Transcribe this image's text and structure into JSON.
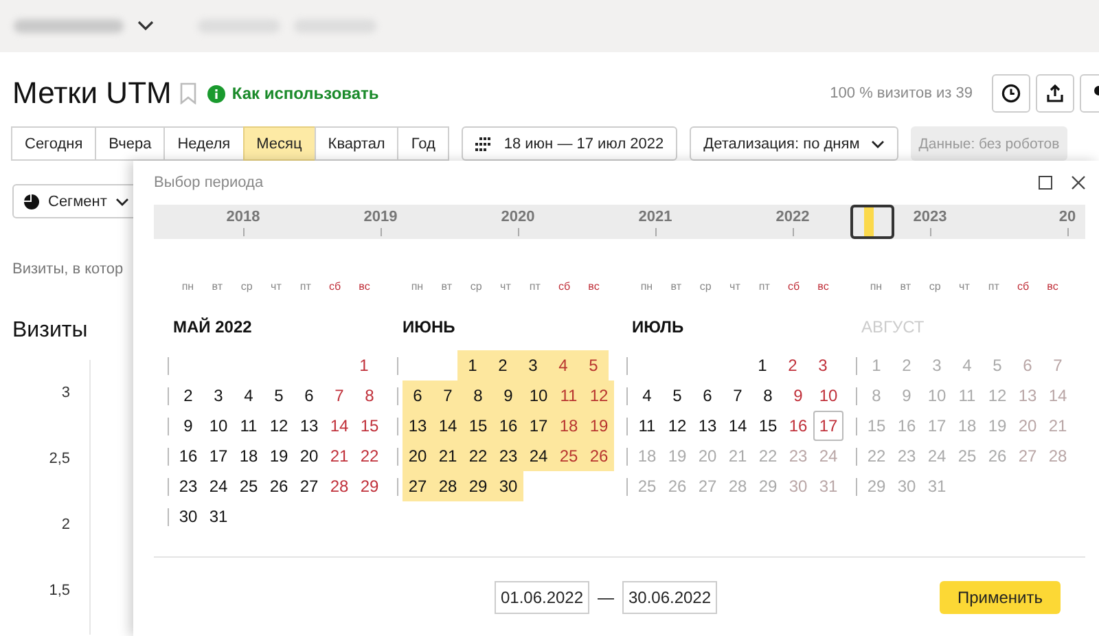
{
  "page": {
    "title": "Метки UTM",
    "help_link": "Как использовать",
    "visits_note": "100 % визитов из 39"
  },
  "periods": [
    {
      "label": "Сегодня",
      "selected": false
    },
    {
      "label": "Вчера",
      "selected": false
    },
    {
      "label": "Неделя",
      "selected": false
    },
    {
      "label": "Месяц",
      "selected": true
    },
    {
      "label": "Квартал",
      "selected": false
    },
    {
      "label": "Год",
      "selected": false
    }
  ],
  "date_range": "18 июн — 17 июл 2022",
  "detail": "Детализация: по дням",
  "data_filter": "Данные: без роботов",
  "segment": "Сегмент",
  "visits_text": "Визиты, в котор",
  "chart_title": "Визиты",
  "y_labels": [
    "3",
    "2,5",
    "2",
    "1,5"
  ],
  "popup": {
    "title": "Выбор периода",
    "years": [
      "2018",
      "2019",
      "2020",
      "2021",
      "2022",
      "2023",
      "20"
    ],
    "months": [
      {
        "name": "МАЙ 2022",
        "disabled": false,
        "weekdays": [
          {
            "label": "пн",
            "weekend": false
          },
          {
            "label": "вт",
            "weekend": false
          },
          {
            "label": "ср",
            "weekend": false
          },
          {
            "label": "чт",
            "weekend": false
          },
          {
            "label": "пт",
            "weekend": false
          },
          {
            "label": "сб",
            "weekend": true
          },
          {
            "label": "вс",
            "weekend": true
          }
        ],
        "weeks": [
          {
            "kind": "first",
            "days": [
              {
                "n": "1",
                "weekend": true,
                "selected": false,
                "disabled": false,
                "today": false
              }
            ]
          },
          {
            "kind": "week",
            "days": [
              {
                "n": "2",
                "weekend": false,
                "selected": false,
                "disabled": false,
                "today": false
              },
              {
                "n": "3",
                "weekend": false,
                "selected": false,
                "disabled": false,
                "today": false
              },
              {
                "n": "4",
                "weekend": false,
                "selected": false,
                "disabled": false,
                "today": false
              },
              {
                "n": "5",
                "weekend": false,
                "selected": false,
                "disabled": false,
                "today": false
              },
              {
                "n": "6",
                "weekend": false,
                "selected": false,
                "disabled": false,
                "today": false
              },
              {
                "n": "7",
                "weekend": true,
                "selected": false,
                "disabled": false,
                "today": false
              },
              {
                "n": "8",
                "weekend": true,
                "selected": false,
                "disabled": false,
                "today": false
              }
            ]
          },
          {
            "kind": "week",
            "days": [
              {
                "n": "9",
                "weekend": false,
                "selected": false,
                "disabled": false,
                "today": false
              },
              {
                "n": "10",
                "weekend": false,
                "selected": false,
                "disabled": false,
                "today": false
              },
              {
                "n": "11",
                "weekend": false,
                "selected": false,
                "disabled": false,
                "today": false
              },
              {
                "n": "12",
                "weekend": false,
                "selected": false,
                "disabled": false,
                "today": false
              },
              {
                "n": "13",
                "weekend": false,
                "selected": false,
                "disabled": false,
                "today": false
              },
              {
                "n": "14",
                "weekend": true,
                "selected": false,
                "disabled": false,
                "today": false
              },
              {
                "n": "15",
                "weekend": true,
                "selected": false,
                "disabled": false,
                "today": false
              }
            ]
          },
          {
            "kind": "week",
            "days": [
              {
                "n": "16",
                "weekend": false,
                "selected": false,
                "disabled": false,
                "today": false
              },
              {
                "n": "17",
                "weekend": false,
                "selected": false,
                "disabled": false,
                "today": false
              },
              {
                "n": "18",
                "weekend": false,
                "selected": false,
                "disabled": false,
                "today": false
              },
              {
                "n": "19",
                "weekend": false,
                "selected": false,
                "disabled": false,
                "today": false
              },
              {
                "n": "20",
                "weekend": false,
                "selected": false,
                "disabled": false,
                "today": false
              },
              {
                "n": "21",
                "weekend": true,
                "selected": false,
                "disabled": false,
                "today": false
              },
              {
                "n": "22",
                "weekend": true,
                "selected": false,
                "disabled": false,
                "today": false
              }
            ]
          },
          {
            "kind": "week",
            "days": [
              {
                "n": "23",
                "weekend": false,
                "selected": false,
                "disabled": false,
                "today": false
              },
              {
                "n": "24",
                "weekend": false,
                "selected": false,
                "disabled": false,
                "today": false
              },
              {
                "n": "25",
                "weekend": false,
                "selected": false,
                "disabled": false,
                "today": false
              },
              {
                "n": "26",
                "weekend": false,
                "selected": false,
                "disabled": false,
                "today": false
              },
              {
                "n": "27",
                "weekend": false,
                "selected": false,
                "disabled": false,
                "today": false
              },
              {
                "n": "28",
                "weekend": true,
                "selected": false,
                "disabled": false,
                "today": false
              },
              {
                "n": "29",
                "weekend": true,
                "selected": false,
                "disabled": false,
                "today": false
              }
            ]
          },
          {
            "kind": "week",
            "days": [
              {
                "n": "30",
                "weekend": false,
                "selected": false,
                "disabled": false,
                "today": false
              },
              {
                "n": "31",
                "weekend": false,
                "selected": false,
                "disabled": false,
                "today": false
              }
            ]
          }
        ]
      },
      {
        "name": "ИЮНЬ",
        "disabled": false,
        "weekdays": [
          {
            "label": "пн",
            "weekend": false
          },
          {
            "label": "вт",
            "weekend": false
          },
          {
            "label": "ср",
            "weekend": false
          },
          {
            "label": "чт",
            "weekend": false
          },
          {
            "label": "пт",
            "weekend": false
          },
          {
            "label": "сб",
            "weekend": true
          },
          {
            "label": "вс",
            "weekend": true
          }
        ],
        "weeks": [
          {
            "kind": "first",
            "days": [
              {
                "n": "1",
                "weekend": false,
                "selected": true,
                "disabled": false,
                "today": false
              },
              {
                "n": "2",
                "weekend": false,
                "selected": true,
                "disabled": false,
                "today": false
              },
              {
                "n": "3",
                "weekend": false,
                "selected": true,
                "disabled": false,
                "today": false
              },
              {
                "n": "4",
                "weekend": true,
                "selected": true,
                "disabled": false,
                "today": false
              },
              {
                "n": "5",
                "weekend": true,
                "selected": true,
                "disabled": false,
                "today": false
              }
            ]
          },
          {
            "kind": "week",
            "days": [
              {
                "n": "6",
                "weekend": false,
                "selected": true,
                "disabled": false,
                "today": false
              },
              {
                "n": "7",
                "weekend": false,
                "selected": true,
                "disabled": false,
                "today": false
              },
              {
                "n": "8",
                "weekend": false,
                "selected": true,
                "disabled": false,
                "today": false
              },
              {
                "n": "9",
                "weekend": false,
                "selected": true,
                "disabled": false,
                "today": false
              },
              {
                "n": "10",
                "weekend": false,
                "selected": true,
                "disabled": false,
                "today": false
              },
              {
                "n": "11",
                "weekend": true,
                "selected": true,
                "disabled": false,
                "today": false
              },
              {
                "n": "12",
                "weekend": true,
                "selected": true,
                "disabled": false,
                "today": false
              }
            ]
          },
          {
            "kind": "week",
            "days": [
              {
                "n": "13",
                "weekend": false,
                "selected": true,
                "disabled": false,
                "today": false
              },
              {
                "n": "14",
                "weekend": false,
                "selected": true,
                "disabled": false,
                "today": false
              },
              {
                "n": "15",
                "weekend": false,
                "selected": true,
                "disabled": false,
                "today": false
              },
              {
                "n": "16",
                "weekend": false,
                "selected": true,
                "disabled": false,
                "today": false
              },
              {
                "n": "17",
                "weekend": false,
                "selected": true,
                "disabled": false,
                "today": false
              },
              {
                "n": "18",
                "weekend": true,
                "selected": true,
                "disabled": false,
                "today": false
              },
              {
                "n": "19",
                "weekend": true,
                "selected": true,
                "disabled": false,
                "today": false
              }
            ]
          },
          {
            "kind": "week",
            "days": [
              {
                "n": "20",
                "weekend": false,
                "selected": true,
                "disabled": false,
                "today": false
              },
              {
                "n": "21",
                "weekend": false,
                "selected": true,
                "disabled": false,
                "today": false
              },
              {
                "n": "22",
                "weekend": false,
                "selected": true,
                "disabled": false,
                "today": false
              },
              {
                "n": "23",
                "weekend": false,
                "selected": true,
                "disabled": false,
                "today": false
              },
              {
                "n": "24",
                "weekend": false,
                "selected": true,
                "disabled": false,
                "today": false
              },
              {
                "n": "25",
                "weekend": true,
                "selected": true,
                "disabled": false,
                "today": false
              },
              {
                "n": "26",
                "weekend": true,
                "selected": true,
                "disabled": false,
                "today": false
              }
            ]
          },
          {
            "kind": "week",
            "days": [
              {
                "n": "27",
                "weekend": false,
                "selected": true,
                "disabled": false,
                "today": false
              },
              {
                "n": "28",
                "weekend": false,
                "selected": true,
                "disabled": false,
                "today": false
              },
              {
                "n": "29",
                "weekend": false,
                "selected": true,
                "disabled": false,
                "today": false
              },
              {
                "n": "30",
                "weekend": false,
                "selected": true,
                "disabled": false,
                "today": false
              }
            ]
          }
        ]
      },
      {
        "name": "ИЮЛЬ",
        "disabled": false,
        "weekdays": [
          {
            "label": "пн",
            "weekend": false
          },
          {
            "label": "вт",
            "weekend": false
          },
          {
            "label": "ср",
            "weekend": false
          },
          {
            "label": "чт",
            "weekend": false
          },
          {
            "label": "пт",
            "weekend": false
          },
          {
            "label": "сб",
            "weekend": true
          },
          {
            "label": "вс",
            "weekend": true
          }
        ],
        "weeks": [
          {
            "kind": "first",
            "days": [
              {
                "n": "1",
                "weekend": false,
                "selected": false,
                "disabled": false,
                "today": false
              },
              {
                "n": "2",
                "weekend": true,
                "selected": false,
                "disabled": false,
                "today": false
              },
              {
                "n": "3",
                "weekend": true,
                "selected": false,
                "disabled": false,
                "today": false
              }
            ]
          },
          {
            "kind": "week",
            "days": [
              {
                "n": "4",
                "weekend": false,
                "selected": false,
                "disabled": false,
                "today": false
              },
              {
                "n": "5",
                "weekend": false,
                "selected": false,
                "disabled": false,
                "today": false
              },
              {
                "n": "6",
                "weekend": false,
                "selected": false,
                "disabled": false,
                "today": false
              },
              {
                "n": "7",
                "weekend": false,
                "selected": false,
                "disabled": false,
                "today": false
              },
              {
                "n": "8",
                "weekend": false,
                "selected": false,
                "disabled": false,
                "today": false
              },
              {
                "n": "9",
                "weekend": true,
                "selected": false,
                "disabled": false,
                "today": false
              },
              {
                "n": "10",
                "weekend": true,
                "selected": false,
                "disabled": false,
                "today": false
              }
            ]
          },
          {
            "kind": "week",
            "days": [
              {
                "n": "11",
                "weekend": false,
                "selected": false,
                "disabled": false,
                "today": false
              },
              {
                "n": "12",
                "weekend": false,
                "selected": false,
                "disabled": false,
                "today": false
              },
              {
                "n": "13",
                "weekend": false,
                "selected": false,
                "disabled": false,
                "today": false
              },
              {
                "n": "14",
                "weekend": false,
                "selected": false,
                "disabled": false,
                "today": false
              },
              {
                "n": "15",
                "weekend": false,
                "selected": false,
                "disabled": false,
                "today": false
              },
              {
                "n": "16",
                "weekend": true,
                "selected": false,
                "disabled": false,
                "today": false
              },
              {
                "n": "17",
                "weekend": true,
                "selected": false,
                "disabled": false,
                "today": true
              }
            ]
          },
          {
            "kind": "week",
            "days": [
              {
                "n": "18",
                "weekend": false,
                "selected": false,
                "disabled": true,
                "today": false
              },
              {
                "n": "19",
                "weekend": false,
                "selected": false,
                "disabled": true,
                "today": false
              },
              {
                "n": "20",
                "weekend": false,
                "selected": false,
                "disabled": true,
                "today": false
              },
              {
                "n": "21",
                "weekend": false,
                "selected": false,
                "disabled": true,
                "today": false
              },
              {
                "n": "22",
                "weekend": false,
                "selected": false,
                "disabled": true,
                "today": false
              },
              {
                "n": "23",
                "weekend": true,
                "selected": false,
                "disabled": true,
                "today": false
              },
              {
                "n": "24",
                "weekend": true,
                "selected": false,
                "disabled": true,
                "today": false
              }
            ]
          },
          {
            "kind": "week",
            "days": [
              {
                "n": "25",
                "weekend": false,
                "selected": false,
                "disabled": true,
                "today": false
              },
              {
                "n": "26",
                "weekend": false,
                "selected": false,
                "disabled": true,
                "today": false
              },
              {
                "n": "27",
                "weekend": false,
                "selected": false,
                "disabled": true,
                "today": false
              },
              {
                "n": "28",
                "weekend": false,
                "selected": false,
                "disabled": true,
                "today": false
              },
              {
                "n": "29",
                "weekend": false,
                "selected": false,
                "disabled": true,
                "today": false
              },
              {
                "n": "30",
                "weekend": true,
                "selected": false,
                "disabled": true,
                "today": false
              },
              {
                "n": "31",
                "weekend": true,
                "selected": false,
                "disabled": true,
                "today": false
              }
            ]
          }
        ]
      },
      {
        "name": "АВГУСТ",
        "disabled": true,
        "weekdays": [
          {
            "label": "пн",
            "weekend": false
          },
          {
            "label": "вт",
            "weekend": false
          },
          {
            "label": "ср",
            "weekend": false
          },
          {
            "label": "чт",
            "weekend": false
          },
          {
            "label": "пт",
            "weekend": false
          },
          {
            "label": "сб",
            "weekend": true
          },
          {
            "label": "вс",
            "weekend": true
          }
        ],
        "weeks": [
          {
            "kind": "week",
            "days": [
              {
                "n": "1",
                "weekend": false,
                "selected": false,
                "disabled": true,
                "today": false
              },
              {
                "n": "2",
                "weekend": false,
                "selected": false,
                "disabled": true,
                "today": false
              },
              {
                "n": "3",
                "weekend": false,
                "selected": false,
                "disabled": true,
                "today": false
              },
              {
                "n": "4",
                "weekend": false,
                "selected": false,
                "disabled": true,
                "today": false
              },
              {
                "n": "5",
                "weekend": false,
                "selected": false,
                "disabled": true,
                "today": false
              },
              {
                "n": "6",
                "weekend": true,
                "selected": false,
                "disabled": true,
                "today": false
              },
              {
                "n": "7",
                "weekend": true,
                "selected": false,
                "disabled": true,
                "today": false
              }
            ]
          },
          {
            "kind": "week",
            "days": [
              {
                "n": "8",
                "weekend": false,
                "selected": false,
                "disabled": true,
                "today": false
              },
              {
                "n": "9",
                "weekend": false,
                "selected": false,
                "disabled": true,
                "today": false
              },
              {
                "n": "10",
                "weekend": false,
                "selected": false,
                "disabled": true,
                "today": false
              },
              {
                "n": "11",
                "weekend": false,
                "selected": false,
                "disabled": true,
                "today": false
              },
              {
                "n": "12",
                "weekend": false,
                "selected": false,
                "disabled": true,
                "today": false
              },
              {
                "n": "13",
                "weekend": true,
                "selected": false,
                "disabled": true,
                "today": false
              },
              {
                "n": "14",
                "weekend": true,
                "selected": false,
                "disabled": true,
                "today": false
              }
            ]
          },
          {
            "kind": "week",
            "days": [
              {
                "n": "15",
                "weekend": false,
                "selected": false,
                "disabled": true,
                "today": false
              },
              {
                "n": "16",
                "weekend": false,
                "selected": false,
                "disabled": true,
                "today": false
              },
              {
                "n": "17",
                "weekend": false,
                "selected": false,
                "disabled": true,
                "today": false
              },
              {
                "n": "18",
                "weekend": false,
                "selected": false,
                "disabled": true,
                "today": false
              },
              {
                "n": "19",
                "weekend": false,
                "selected": false,
                "disabled": true,
                "today": false
              },
              {
                "n": "20",
                "weekend": true,
                "selected": false,
                "disabled": true,
                "today": false
              },
              {
                "n": "21",
                "weekend": true,
                "selected": false,
                "disabled": true,
                "today": false
              }
            ]
          },
          {
            "kind": "week",
            "days": [
              {
                "n": "22",
                "weekend": false,
                "selected": false,
                "disabled": true,
                "today": false
              },
              {
                "n": "23",
                "weekend": false,
                "selected": false,
                "disabled": true,
                "today": false
              },
              {
                "n": "24",
                "weekend": false,
                "selected": false,
                "disabled": true,
                "today": false
              },
              {
                "n": "25",
                "weekend": false,
                "selected": false,
                "disabled": true,
                "today": false
              },
              {
                "n": "26",
                "weekend": false,
                "selected": false,
                "disabled": true,
                "today": false
              },
              {
                "n": "27",
                "weekend": true,
                "selected": false,
                "disabled": true,
                "today": false
              },
              {
                "n": "28",
                "weekend": true,
                "selected": false,
                "disabled": true,
                "today": false
              }
            ]
          },
          {
            "kind": "week",
            "days": [
              {
                "n": "29",
                "weekend": false,
                "selected": false,
                "disabled": true,
                "today": false
              },
              {
                "n": "30",
                "weekend": false,
                "selected": false,
                "disabled": true,
                "today": false
              },
              {
                "n": "31",
                "weekend": false,
                "selected": false,
                "disabled": true,
                "today": false
              }
            ]
          }
        ]
      }
    ],
    "date_from": "01.06.2022",
    "date_separator": "—",
    "date_to": "30.06.2022",
    "apply_button": "Применить"
  }
}
